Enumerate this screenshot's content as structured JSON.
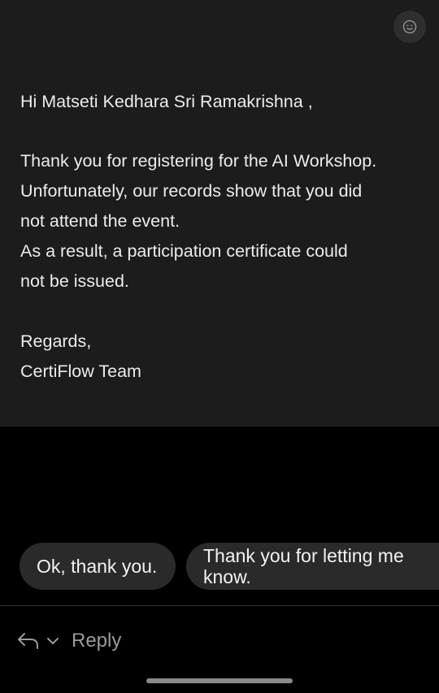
{
  "email": {
    "greeting": "Hi Matseti Kedhara Sri Ramakrishna ,",
    "body_lines": [
      "Thank you for registering for the AI Workshop.",
      "Unfortunately, our records show that you did",
      "not attend the event.",
      "As a result, a participation certificate could",
      "not be issued."
    ],
    "closing": "Regards,",
    "signature": "CertiFlow Team",
    "reaction_icon": "smiley-icon"
  },
  "smart_replies": [
    {
      "label": "Ok, thank you."
    },
    {
      "label": "Thank you for letting me know."
    }
  ],
  "reply_bar": {
    "reply_label": "Reply",
    "reply_icon": "reply-arrow-icon",
    "dropdown_icon": "chevron-down-icon"
  }
}
